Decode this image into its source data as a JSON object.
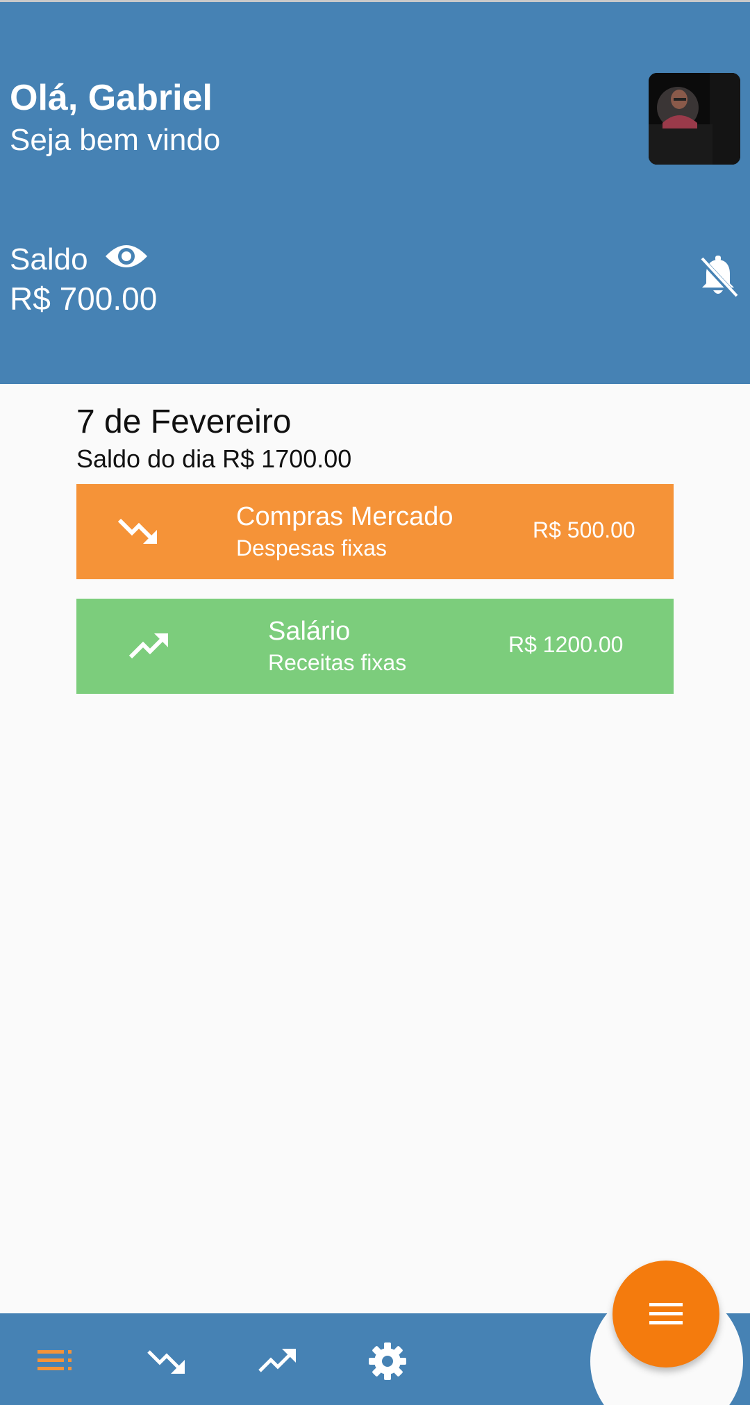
{
  "header": {
    "greeting": "Olá, Gabriel",
    "subtitle": "Seja bem vindo",
    "balance_label": "Saldo",
    "balance_value": "R$ 700.00"
  },
  "day": {
    "title": "7 de Fevereiro",
    "balance": "Saldo do dia R$ 1700.00"
  },
  "transactions": [
    {
      "type": "expense",
      "icon": "trending-down-icon",
      "title": "Compras Mercado",
      "category": "Despesas fixas",
      "value": "R$ 500.00",
      "color": "#f59338"
    },
    {
      "type": "income",
      "icon": "trending-up-icon",
      "title": "Salário",
      "category": "Receitas fixas",
      "value": "R$ 1200.00",
      "color": "#7ccd7c"
    }
  ],
  "bottom_nav": {
    "items": [
      {
        "icon": "list-icon",
        "active": true
      },
      {
        "icon": "trending-down-icon",
        "active": false
      },
      {
        "icon": "trending-up-icon",
        "active": false
      },
      {
        "icon": "settings-icon",
        "active": false
      }
    ],
    "fab_icon": "menu-icon"
  },
  "colors": {
    "primary": "#4682b4",
    "accent": "#f47b0d",
    "expense": "#f59338",
    "income": "#7ccd7c"
  }
}
